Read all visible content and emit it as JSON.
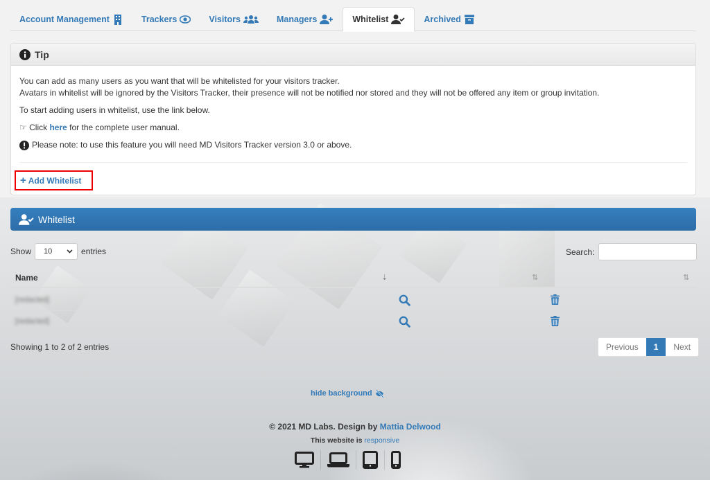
{
  "colors": {
    "link": "#337ab7",
    "primary": "#337ab7",
    "highlight_border": "#e00000",
    "text": "#333333"
  },
  "tabs": [
    {
      "label": "Account Management",
      "icon": "building-icon",
      "active": false
    },
    {
      "label": "Trackers",
      "icon": "eye-icon",
      "active": false
    },
    {
      "label": "Visitors",
      "icon": "users-icon",
      "active": false
    },
    {
      "label": "Managers",
      "icon": "user-plus-icon",
      "active": false
    },
    {
      "label": "Whitelist",
      "icon": "user-check-icon",
      "active": true
    },
    {
      "label": "Archived",
      "icon": "archive-icon",
      "active": false
    }
  ],
  "tip": {
    "title": "Tip",
    "line1": "You can add as many users as you want that will be whitelisted for your visitors tracker.",
    "line2": "Avatars in whitelist will be ignored by the Visitors Tracker, their presence will not be notified nor stored and they will not be offered any item or group invitation.",
    "line3": "To start adding users in whitelist, use the link below.",
    "manual_prefix": "Click",
    "manual_link": "here",
    "manual_suffix": "for the complete user manual.",
    "note": "Please note: to use this feature you will need MD Visitors Tracker version 3.0 or above.",
    "add_button": "Add Whitelist"
  },
  "whitelist": {
    "title": "Whitelist",
    "show_label": "Show",
    "page_length": "10",
    "entries_label": "entries",
    "search_label": "Search:",
    "search_value": "",
    "columns": [
      "Name",
      "",
      ""
    ],
    "rows": [
      {
        "name": "[redacted]"
      },
      {
        "name": "[redacted]"
      }
    ],
    "info": "Showing 1 to 2 of 2 entries",
    "pagination": {
      "previous": "Previous",
      "current": "1",
      "next": "Next"
    }
  },
  "footer": {
    "hide_background": "hide background",
    "copyright": "2021 MD Labs. Design by",
    "designer": "Mattia Delwood",
    "responsive_prefix": "This website is",
    "responsive_link": "responsive",
    "devices": [
      "desktop-icon",
      "laptop-icon",
      "tablet-icon",
      "mobile-icon"
    ]
  }
}
